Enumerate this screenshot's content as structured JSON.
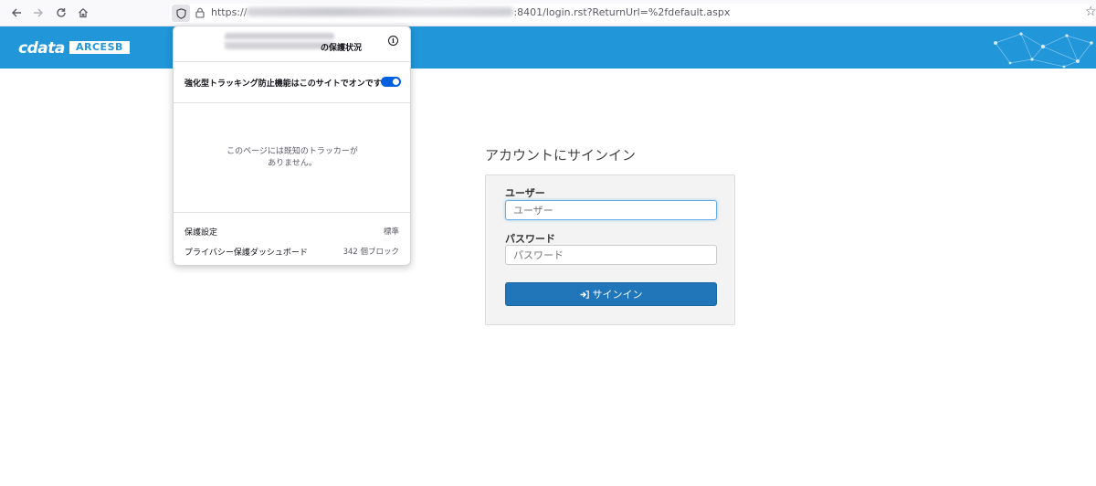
{
  "browser": {
    "url_prefix": "https://",
    "url_suffix": ":8401/login.rst?ReturnUrl=%2fdefault.aspx",
    "icons": {
      "back": "back-arrow-icon",
      "forward": "forward-arrow-icon",
      "reload": "reload-icon",
      "home": "home-icon",
      "shield": "shield-icon",
      "lock": "lock-icon",
      "bookmark": "star-icon"
    }
  },
  "app": {
    "logo_text": "cdata",
    "logo_badge": "ARCESB",
    "header_color": "#2196d9"
  },
  "signin": {
    "title": "アカウントにサインイン",
    "user_label": "ユーザー",
    "user_placeholder": "ユーザー",
    "password_label": "パスワード",
    "password_placeholder": "パスワード",
    "button_label": "サインイン",
    "button_icon": "sign-in-icon",
    "button_color": "#2076b8"
  },
  "tracking_popup": {
    "title": "の保護状況",
    "toggle_label": "強化型トラッキング防止機能はこのサイトでオンです",
    "toggle_on": true,
    "message": "このページには既知のトラッカーがありません。",
    "settings_label": "保護設定",
    "settings_value": "標準",
    "dashboard_label": "プライバシー保護ダッシュボード",
    "dashboard_value": "342 個ブロック"
  }
}
